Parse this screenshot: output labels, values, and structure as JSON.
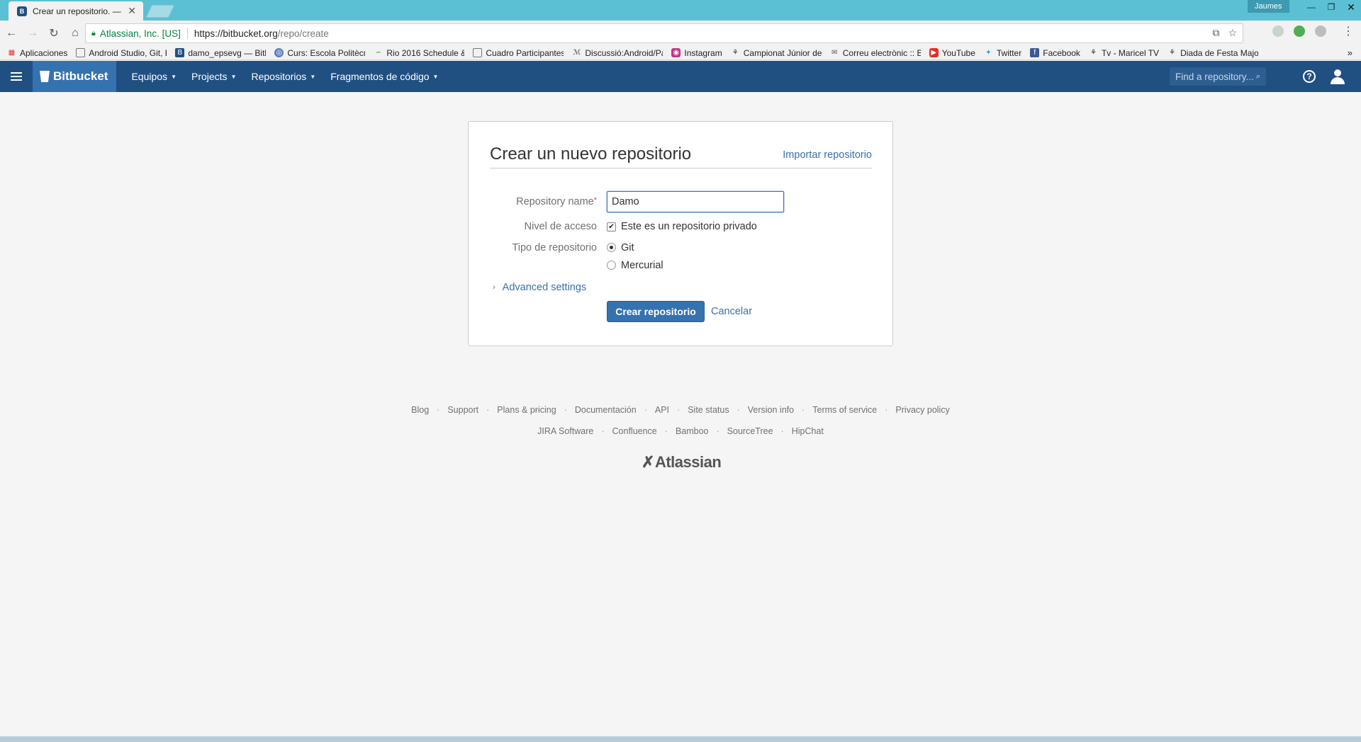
{
  "browser": {
    "tab_title": "Crear un repositorio. — Bitbucket",
    "profile_name": "Jaumes",
    "secure_label": "Atlassian, Inc. [US]",
    "url_host": "https://bitbucket.org",
    "url_path": "/repo/create",
    "accent_color": "#5bc0d4"
  },
  "bookmarks": [
    {
      "label": "Aplicaciones",
      "icon": "apps-grid-icon"
    },
    {
      "label": "Android Studio, Git, B",
      "icon": "page-icon"
    },
    {
      "label": "damo_epsevg — Bitb",
      "icon": "bitbucket-icon"
    },
    {
      "label": "Curs: Escola Politècnic",
      "icon": "globe-icon"
    },
    {
      "label": "Rio 2016 Schedule &",
      "icon": "rio-icon"
    },
    {
      "label": "Cuadro Participantes",
      "icon": "page-icon"
    },
    {
      "label": "Discussió:Android/Pat",
      "icon": "wiki-icon"
    },
    {
      "label": "Instagram",
      "icon": "instagram-icon"
    },
    {
      "label": "Campionat Júnior de",
      "icon": "castellers-icon"
    },
    {
      "label": "Correu electrònic :: Be",
      "icon": "mail-icon"
    },
    {
      "label": "YouTube",
      "icon": "youtube-icon"
    },
    {
      "label": "Twitter",
      "icon": "twitter-icon"
    },
    {
      "label": "Facebook",
      "icon": "facebook-icon"
    },
    {
      "label": "Tv - Maricel TV",
      "icon": "castellers-icon"
    },
    {
      "label": "Diada de Festa Major",
      "icon": "castellers-icon"
    }
  ],
  "bitbucket_nav": {
    "logo": "Bitbucket",
    "links": [
      "Equipos",
      "Projects",
      "Repositorios",
      "Fragmentos de código"
    ],
    "search_placeholder": "Find a repository...",
    "brand_color": "#205081"
  },
  "form": {
    "title": "Crear un nuevo repositorio",
    "import_link": "Importar repositorio",
    "repo_name_label": "Repository name",
    "repo_name_value": "Damo",
    "access_label": "Nivel de acceso",
    "private_checkbox_label": "Este es un repositorio privado",
    "private_checked": true,
    "type_label": "Tipo de repositorio",
    "type_options": [
      "Git",
      "Mercurial"
    ],
    "type_selected": "Git",
    "advanced_settings": "Advanced settings",
    "submit_label": "Crear repositorio",
    "cancel_label": "Cancelar"
  },
  "footer": {
    "row1": [
      "Blog",
      "Support",
      "Plans & pricing",
      "Documentación",
      "API",
      "Site status",
      "Version info",
      "Terms of service",
      "Privacy policy"
    ],
    "row2": [
      "JIRA Software",
      "Confluence",
      "Bamboo",
      "SourceTree",
      "HipChat"
    ],
    "logo": "Atlassian"
  }
}
